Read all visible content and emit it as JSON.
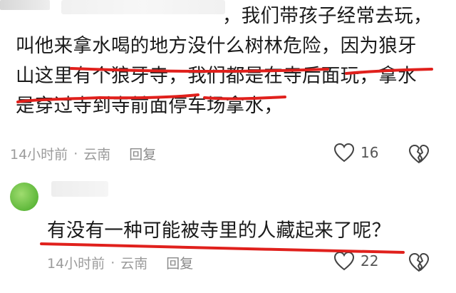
{
  "comment": {
    "lines": [
      "，我们带孩子经常去玩，",
      "叫他来拿水喝的地方没什么树林危险，因为狼牙",
      "山这里有个狼牙寺，我们都是在寺后面玩，拿水",
      "是穿过寺到寺前面停车场拿水，"
    ],
    "time": "14小时前",
    "separator": "·",
    "location": "云南",
    "reply_label": "回复",
    "likes": "16"
  },
  "reply": {
    "text": "有没有一种可能被寺里的人藏起来了呢？",
    "time": "14小时前",
    "separator": "·",
    "location": "云南",
    "reply_label": "回复",
    "likes": "22"
  },
  "colors": {
    "underline": "#e0201c",
    "meta_text": "#9b9b9b",
    "avatar_green": "#5fb83b"
  },
  "icons": [
    "heart-icon",
    "broken-heart-icon"
  ]
}
